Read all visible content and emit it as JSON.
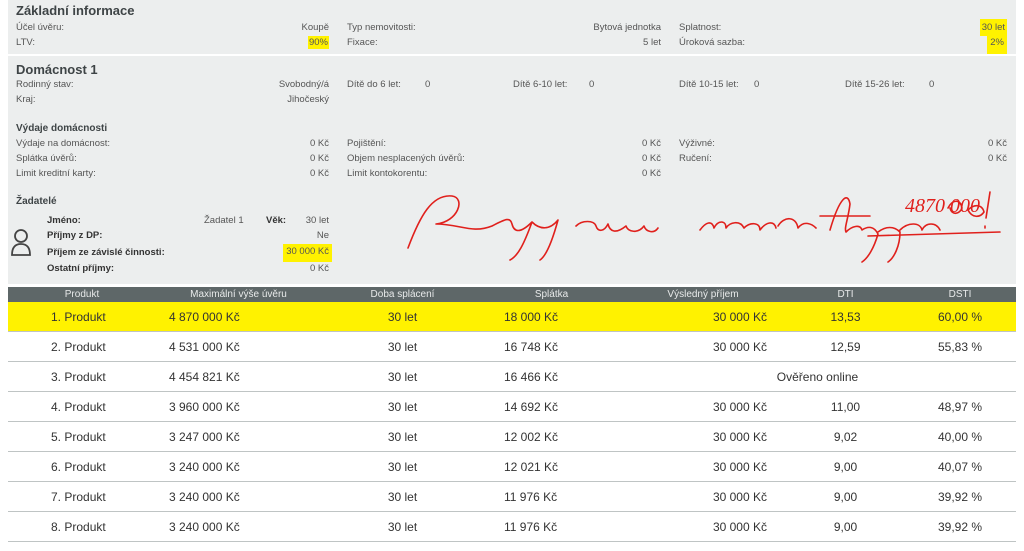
{
  "basic": {
    "title": "Základní informace",
    "purpose_label": "Účel úvěru:",
    "purpose_value": "Koupě",
    "ltv_label": "LTV:",
    "ltv_value": "90%",
    "property_type_label": "Typ nemovitosti:",
    "property_type_value": "Bytová jednotka",
    "fixation_label": "Fixace:",
    "fixation_value": "5 let",
    "maturity_label": "Splatnost:",
    "maturity_value": "30 let",
    "rate_label": "Úroková sazba:",
    "rate_value": "2%"
  },
  "household": {
    "title": "Domácnost 1",
    "marital_label": "Rodinný stav:",
    "marital_value": "Svobodný/á",
    "region_label": "Kraj:",
    "region_value": "Jihočeský",
    "child_0_6_label": "Dítě do 6 let:",
    "child_0_6_value": "0",
    "child_6_10_label": "Dítě 6-10 let:",
    "child_6_10_value": "0",
    "child_10_15_label": "Dítě 10-15 let:",
    "child_10_15_value": "0",
    "child_15_26_label": "Dítě 15-26 let:",
    "child_15_26_value": "0"
  },
  "expenses": {
    "title": "Výdaje domácnosti",
    "household_label": "Výdaje na domácnost:",
    "household_value": "0 Kč",
    "loan_label": "Splátka úvěrů:",
    "loan_value": "0 Kč",
    "card_label": "Limit kreditní karty:",
    "card_value": "0 Kč",
    "insurance_label": "Pojištění:",
    "insurance_value": "0 Kč",
    "unpaid_label": "Objem nesplacených úvěrů:",
    "unpaid_value": "0 Kč",
    "overdraft_label": "Limit kontokorentu:",
    "overdraft_value": "0 Kč",
    "alimony_label": "Výživné:",
    "alimony_value": "0 Kč",
    "guarantee_label": "Ručení:",
    "guarantee_value": "0 Kč"
  },
  "applicants": {
    "title": "Žadatelé",
    "name_label": "Jméno:",
    "name_value": "Žadatel 1",
    "age_label": "Věk:",
    "age_value": "30 let",
    "dp_label": "Příjmy z DP:",
    "dp_value": "Ne",
    "employment_label": "Příjem ze závislé činnosti:",
    "employment_value": "30 000 Kč",
    "other_label": "Ostatní příjmy:",
    "other_value": "0 Kč"
  },
  "note": "Pepy max hypo 4870 000!",
  "table": {
    "headers": [
      "Produkt",
      "Maximální výše úvěru",
      "Doba splácení",
      "Splátka",
      "Výsledný příjem",
      "DTI",
      "DSTI"
    ],
    "rows": [
      [
        "1. Produkt",
        "4 870 000 Kč",
        "30 let",
        "18 000 Kč",
        "30 000 Kč",
        "13,53",
        "60,00 %"
      ],
      [
        "2. Produkt",
        "4 531 000 Kč",
        "30 let",
        "16 748 Kč",
        "30 000 Kč",
        "12,59",
        "55,83 %"
      ],
      [
        "3. Produkt",
        "4 454 821 Kč",
        "30 let",
        "16 466 Kč",
        "Ověřeno online",
        "",
        ""
      ],
      [
        "4. Produkt",
        "3 960 000 Kč",
        "30 let",
        "14 692 Kč",
        "30 000 Kč",
        "11,00",
        "48,97 %"
      ],
      [
        "5. Produkt",
        "3 247 000 Kč",
        "30 let",
        "12 002 Kč",
        "30 000 Kč",
        "9,02",
        "40,00 %"
      ],
      [
        "6. Produkt",
        "3 240 000 Kč",
        "30 let",
        "12 021 Kč",
        "30 000 Kč",
        "9,00",
        "40,07 %"
      ],
      [
        "7. Produkt",
        "3 240 000 Kč",
        "30 let",
        "11 976 Kč",
        "30 000 Kč",
        "9,00",
        "39,92 %"
      ],
      [
        "8. Produkt",
        "3 240 000 Kč",
        "30 let",
        "11 976 Kč",
        "30 000 Kč",
        "9,00",
        "39,92 %"
      ]
    ]
  },
  "colors": {
    "highlight": "#fff200",
    "header_bg": "#5e6768",
    "panel_bg": "#eceeee",
    "ink": "#e0201c"
  }
}
